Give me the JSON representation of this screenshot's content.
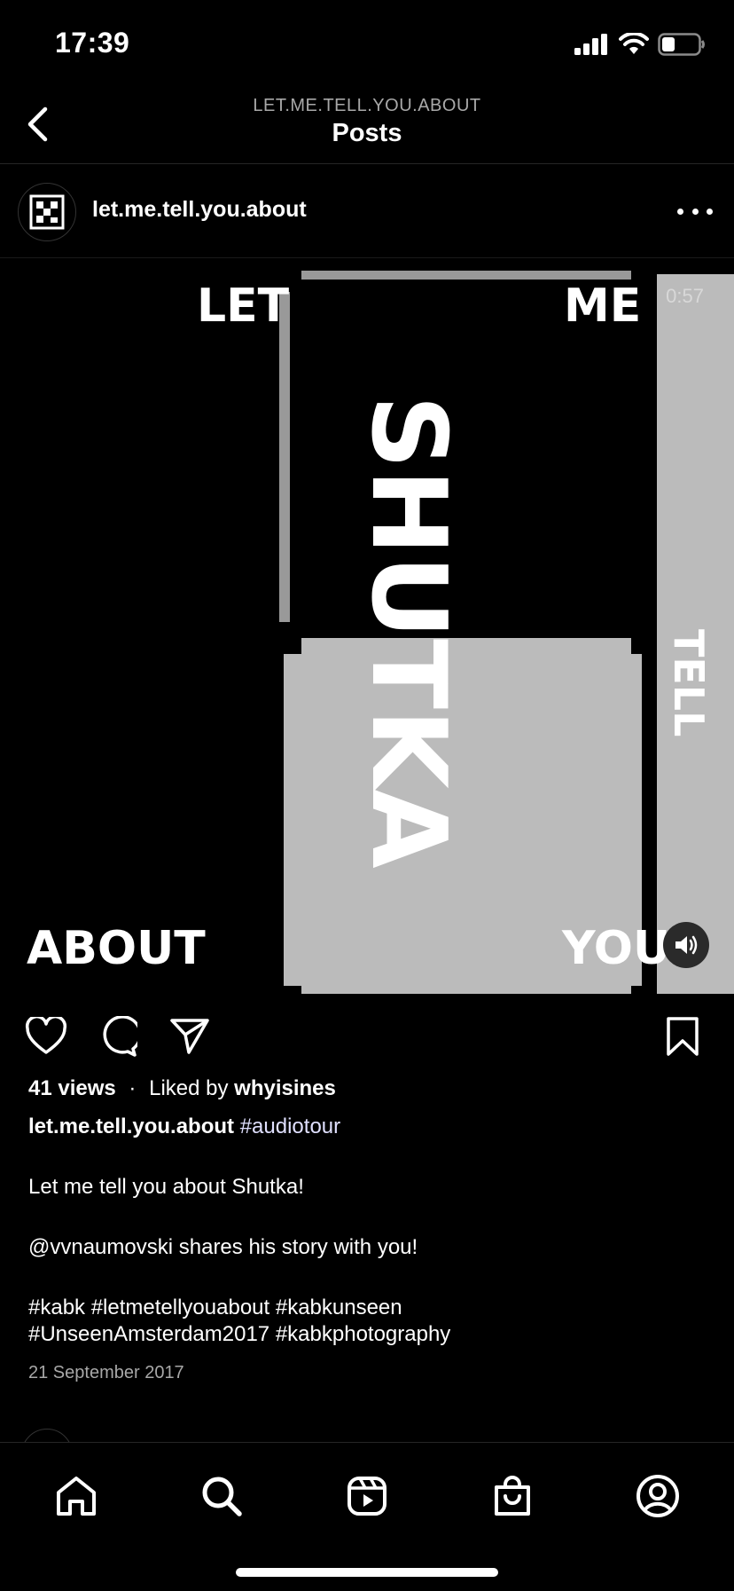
{
  "status": {
    "time": "17:39"
  },
  "nav": {
    "subtitle": "LET.ME.TELL.YOU.ABOUT",
    "title": "Posts"
  },
  "post": {
    "author": "let.me.tell.you.about",
    "media": {
      "words": {
        "let": "LET",
        "me": "ME",
        "shutka": "SHUTKA",
        "tell": "TELL",
        "about": "ABOUT",
        "you": "YOU"
      },
      "duration": "0:57"
    },
    "stats": {
      "views": "41 views",
      "separator": "·",
      "liked_prefix": "Liked by",
      "liked_user": "whyisines"
    },
    "caption": {
      "username": "let.me.tell.you.about",
      "first_tag": "#audiotour",
      "line1": "Let me tell you about Shutka!",
      "line2": "@vvnaumovski shares his story with you!",
      "tags1": "#kabk #letmetellyouabout #kabkunseen",
      "tags2": "#UnseenAmsterdam2017 #kabkphotography"
    },
    "date": "21 September 2017"
  },
  "icons": {
    "back": "chevron-left-icon",
    "more": "more-horizontal-icon",
    "like": "heart-icon",
    "comment": "comment-icon",
    "share": "paper-plane-icon",
    "save": "bookmark-icon",
    "sound": "speaker-icon",
    "home": "home-icon",
    "search": "search-icon",
    "reels": "reels-icon",
    "shop": "shopping-bag-icon",
    "profile": "profile-icon"
  },
  "colors": {
    "background": "#000000",
    "panel_gray": "#bbbbbb",
    "muted_text": "#a8a8a8"
  }
}
